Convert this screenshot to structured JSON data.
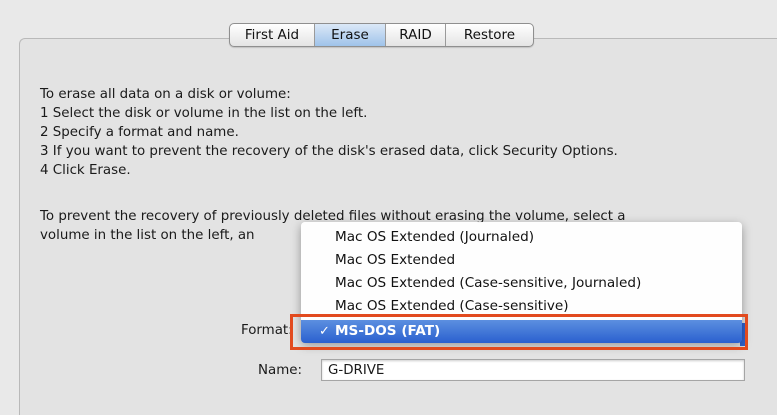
{
  "tabs": [
    {
      "label": "First Aid"
    },
    {
      "label": "Erase"
    },
    {
      "label": "RAID"
    },
    {
      "label": "Restore"
    }
  ],
  "instructions": {
    "line1": "To erase all data on a disk or volume:",
    "line2": "1 Select the disk or volume in the list on the left.",
    "line3": "2 Specify a format and name.",
    "line4": "3 If you want to prevent the recovery of the disk's erased data, click Security Options.",
    "line5": "4 Click Erase.",
    "para2_line1": "To prevent the recovery of previously deleted files without erasing the volume, select a",
    "para2_line2": "volume in the list on the left, an"
  },
  "format": {
    "label": "Format:",
    "options": [
      "Mac OS Extended (Journaled)",
      "Mac OS Extended",
      "Mac OS Extended (Case-sensitive, Journaled)",
      "Mac OS Extended (Case-sensitive)",
      "MS-DOS (FAT)"
    ],
    "selected": "MS-DOS (FAT)",
    "check": "✓"
  },
  "name": {
    "label": "Name:",
    "value": "G-DRIVE"
  },
  "colors": {
    "highlight": "#e24a1e",
    "selection": "#2a60cf"
  }
}
